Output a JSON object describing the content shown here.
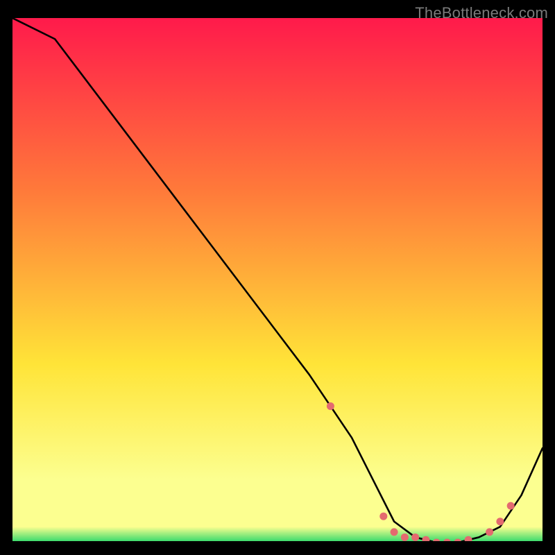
{
  "watermark": "TheBottleneck.com",
  "colors": {
    "gradient_top": "#ff1a4b",
    "gradient_mid1": "#ff7a3a",
    "gradient_mid2": "#ffe438",
    "gradient_low": "#fcff90",
    "gradient_bottom": "#2bd86a",
    "curve": "#000000",
    "marker": "#e46a6f",
    "black": "#000000"
  },
  "chart_data": {
    "type": "line",
    "title": "",
    "xlabel": "",
    "ylabel": "",
    "xlim": [
      0,
      100
    ],
    "ylim": [
      0,
      100
    ],
    "x": [
      0,
      8,
      14,
      20,
      26,
      32,
      38,
      44,
      50,
      56,
      60,
      64,
      68,
      72,
      76,
      80,
      84,
      88,
      92,
      96,
      100
    ],
    "values": [
      100,
      96,
      88,
      80,
      72,
      64,
      56,
      48,
      40,
      32,
      26,
      20,
      12,
      4,
      1,
      0,
      0,
      1,
      3,
      9,
      18
    ],
    "markers_x": [
      60,
      70,
      72,
      74,
      76,
      78,
      80,
      82,
      84,
      86,
      90,
      92,
      94
    ],
    "markers_y": [
      26,
      5,
      2,
      1,
      1,
      0.5,
      0,
      0,
      0,
      0.5,
      2,
      4,
      7
    ]
  }
}
